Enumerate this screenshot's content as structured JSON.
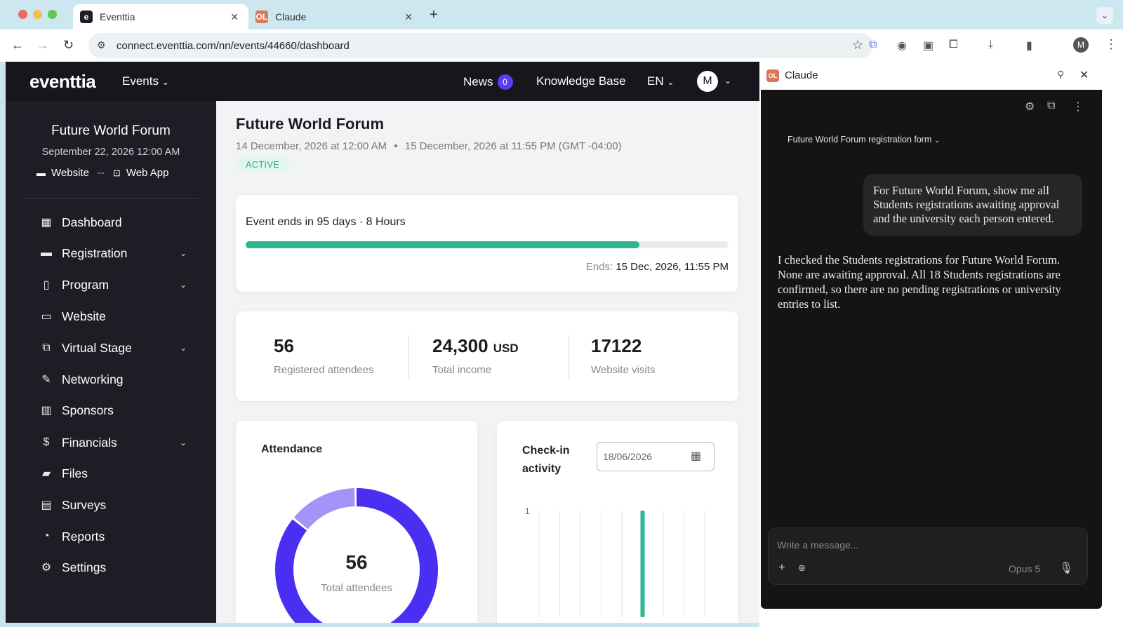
{
  "browser": {
    "tabs": [
      {
        "title": "Eventtia",
        "favicon": "e"
      },
      {
        "title": "Claude",
        "favicon": "OL"
      }
    ],
    "url": "connect.eventtia.com/nn/events/44660/dashboard",
    "profile_initial": "M"
  },
  "app": {
    "logo": "eventtia",
    "events_menu": "Events",
    "news_label": "News",
    "news_count": "0",
    "knowledge_base": "Knowledge Base",
    "language": "EN",
    "user_initial": "M"
  },
  "sidebar": {
    "event_title": "Future World Forum",
    "event_date": "September 22, 2026 12:00 AM",
    "website_link": "Website",
    "separator": "--",
    "webapp_link": "Web App",
    "items": [
      {
        "label": "Dashboard",
        "icon": "dashboard-icon",
        "glyph": "▦",
        "expandable": false
      },
      {
        "label": "Registration",
        "icon": "registration-icon",
        "glyph": "▬",
        "expandable": true
      },
      {
        "label": "Program",
        "icon": "program-icon",
        "glyph": "▯",
        "expandable": true
      },
      {
        "label": "Website",
        "icon": "website-icon",
        "glyph": "▭",
        "expandable": false
      },
      {
        "label": "Virtual Stage",
        "icon": "virtual-stage-icon",
        "glyph": "⧉",
        "expandable": true
      },
      {
        "label": "Networking",
        "icon": "networking-icon",
        "glyph": "✎",
        "expandable": false
      },
      {
        "label": "Sponsors",
        "icon": "sponsors-icon",
        "glyph": "▥",
        "expandable": false
      },
      {
        "label": "Financials",
        "icon": "financials-icon",
        "glyph": "$",
        "expandable": true
      },
      {
        "label": "Files",
        "icon": "files-icon",
        "glyph": "▰",
        "expandable": false
      },
      {
        "label": "Surveys",
        "icon": "surveys-icon",
        "glyph": "▤",
        "expandable": false
      },
      {
        "label": "Reports",
        "icon": "reports-icon",
        "glyph": "◔",
        "expandable": false
      },
      {
        "label": "Settings",
        "icon": "settings-icon",
        "glyph": "⚙",
        "expandable": false
      }
    ]
  },
  "main": {
    "title": "Future World Forum",
    "start": "14 December, 2026 at 12:00 AM",
    "dot": "•",
    "end": "15 December, 2026 at 11:55 PM (GMT -04:00)",
    "status": "ACTIVE",
    "ends_text": "Event ends in 95 days · 8 Hours",
    "progress_fraction": 0.815,
    "ends_label": "Ends:",
    "ends_value": "15 Dec, 2026, 11:55 PM",
    "stats": [
      {
        "value": "56",
        "unit": "",
        "label": "Registered attendees"
      },
      {
        "value": "24,300",
        "unit": "USD",
        "label": "Total income"
      },
      {
        "value": "17122",
        "unit": "",
        "label": "Website visits"
      }
    ],
    "attendance": {
      "title": "Attendance",
      "total": "56",
      "total_label": "Total attendees",
      "segments": [
        {
          "fraction": 0.86,
          "color": "#4a2ef2"
        },
        {
          "fraction": 0.14,
          "color": "#a593f7"
        }
      ]
    },
    "checkin": {
      "title": "Check-in activity",
      "date": "18/06/2026",
      "y_tick": "1",
      "bar_index": 5,
      "bar_value": 1,
      "columns": 9
    }
  },
  "claude_panel": {
    "title": "Claude",
    "conversation_title": "Future World Forum registration form",
    "user_message": "For Future World Forum, show me all Students registrations awaiting approval and the university each person entered.",
    "assistant_message": "I checked the Students registrations for Future World Forum. None are awaiting approval. All 18 Students registrations are confirmed, so there are no pending registrations or university entries to list.",
    "input_placeholder": "Write a message...",
    "model": "Opus 5"
  },
  "colors": {
    "accent": "#5b3df5",
    "progress": "#2eb592",
    "sidebar_bg": "#1d1d25",
    "topnav_bg": "#16161d"
  }
}
